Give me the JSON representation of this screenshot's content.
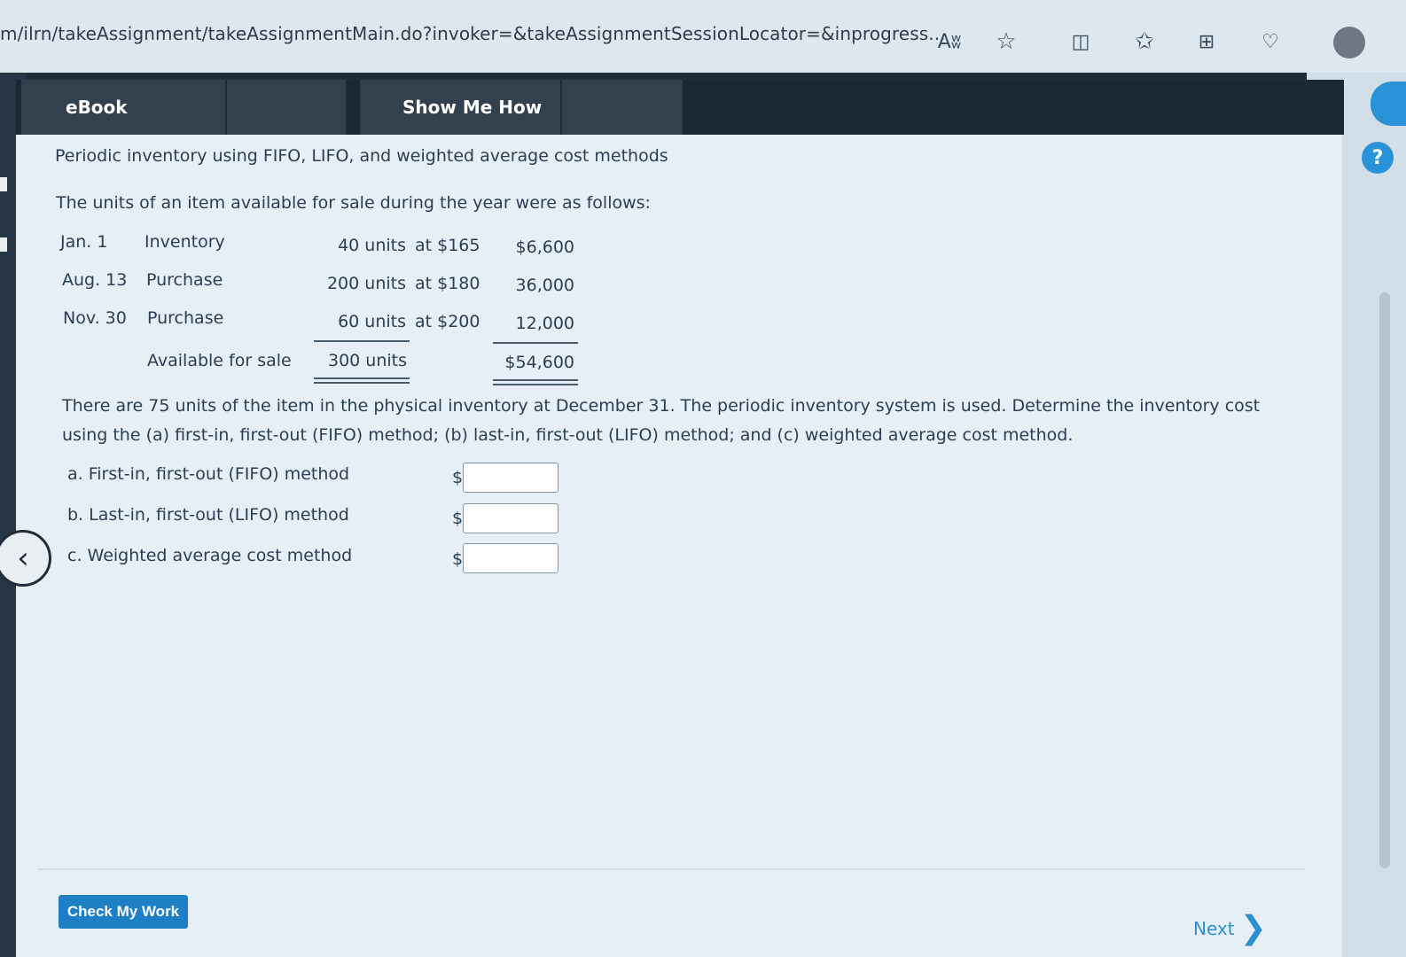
{
  "browser": {
    "url": "m/ilrn/takeAssignment/takeAssignmentMain.do?invoker=&takeAssignmentSessionLocator=&inprogress...",
    "read_aloud_label": "Aʬ"
  },
  "tabs": [
    {
      "label": "eBook"
    },
    {
      "label": "Show Me How"
    }
  ],
  "problem": {
    "title": "Periodic inventory using FIFO, LIFO, and weighted average cost methods",
    "intro": "The units of an item available for sale during the year were as follows:",
    "rows": [
      {
        "date": "Jan. 1",
        "desc": "Inventory",
        "units": "40 units",
        "at": "at $165",
        "cost": "$6,600"
      },
      {
        "date": "Aug. 13",
        "desc": "Purchase",
        "units": "200 units",
        "at": "at $180",
        "cost": "36,000"
      },
      {
        "date": "Nov. 30",
        "desc": "Purchase",
        "units": "60 units",
        "at": "at $200",
        "cost": "12,000"
      }
    ],
    "total": {
      "desc": "Available for sale",
      "units": "300 units",
      "cost": "$54,600"
    },
    "question": "There are 75 units of the item in the physical inventory at December 31. The periodic inventory system is used. Determine the inventory cost using the (a) first-in, first-out (FIFO) method; (b) last-in, first-out (LIFO) method; and (c) weighted average cost method."
  },
  "answers": [
    {
      "label": "a. First-in, first-out (FIFO) method",
      "currency": "$",
      "value": ""
    },
    {
      "label": "b. Last-in, first-out (LIFO) method",
      "currency": "$",
      "value": ""
    },
    {
      "label": "c. Weighted average cost method",
      "currency": "$",
      "value": ""
    }
  ],
  "footer": {
    "check_label": "Check My Work",
    "next_label": "Next"
  },
  "colors": {
    "accent": "#1f7fc4",
    "tab_bar": "#1c2835",
    "content_bg": "#e6eff5"
  }
}
